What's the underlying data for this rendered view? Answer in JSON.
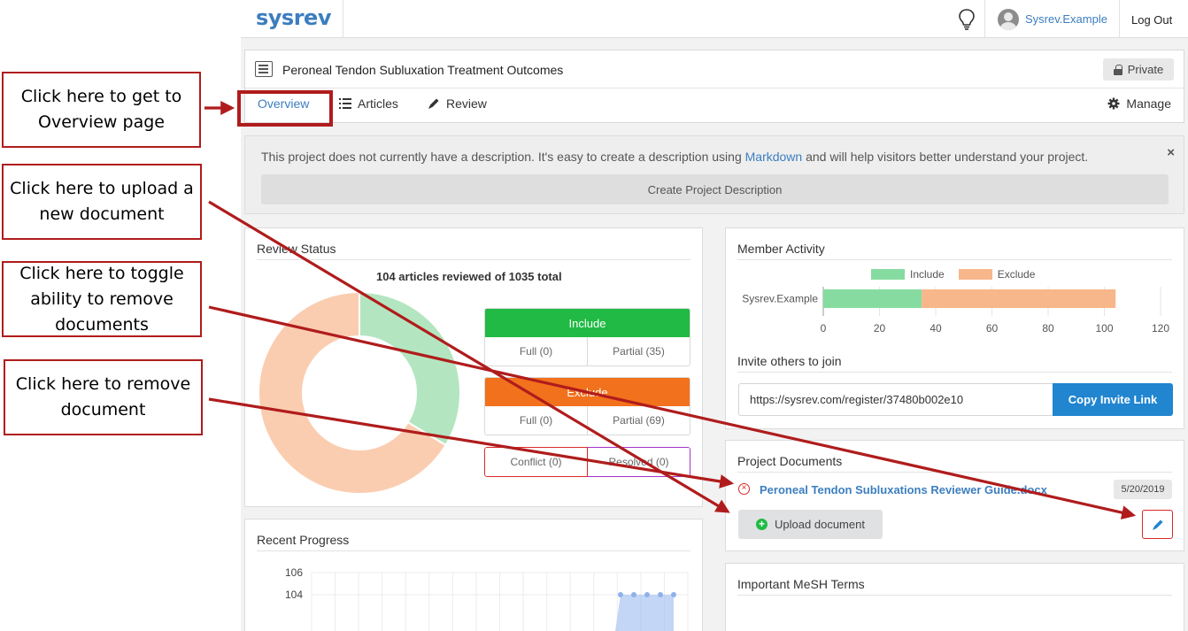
{
  "callouts": {
    "overview": "Click here to get to Overview page",
    "upload": "Click here to upload a new document",
    "toggle": "Click here to toggle ability to remove documents",
    "remove": "Click here to remove document"
  },
  "topbar": {
    "logo": "sysrev",
    "icons": [
      "lightbulb-icon",
      "avatar-icon"
    ],
    "username": "Sysrev.Example",
    "logout_label": "Log Out"
  },
  "project": {
    "title": "Peroneal Tendon Subluxation Treatment Outcomes",
    "visibility_label": "Private",
    "tabs": {
      "overview": "Overview",
      "articles": "Articles",
      "review": "Review",
      "manage": "Manage"
    }
  },
  "description_banner": {
    "text_before": "This project does not currently have a description. It's easy to create a description using ",
    "link": "Markdown",
    "text_after": " and will help visitors better understand your project.",
    "close": "×",
    "button_label": "Create Project Description"
  },
  "review_status": {
    "title": "Review Status",
    "caption": "104 articles reviewed of 1035 total",
    "include": {
      "label": "Include",
      "full": "Full (0)",
      "partial": "Partial (35)"
    },
    "exclude": {
      "label": "Exclude",
      "full": "Full (0)",
      "partial": "Partial (69)"
    },
    "conflict": "Conflict (0)",
    "resolved": "Resolved (0)",
    "chart_data": {
      "type": "pie",
      "categories": [
        "Include",
        "Exclude"
      ],
      "values": [
        35,
        69
      ],
      "colors": [
        "#b3e6c0",
        "#fbcdb0"
      ]
    }
  },
  "recent_progress": {
    "title": "Recent Progress",
    "chart_data": {
      "type": "area",
      "y_ticks": [
        "106",
        "104"
      ],
      "values": [
        104,
        104,
        104,
        104,
        104
      ],
      "color": "#a9c4f2"
    }
  },
  "member_activity": {
    "title": "Member Activity",
    "chart_data": {
      "type": "bar",
      "orientation": "horizontal",
      "stacked": true,
      "categories": [
        "Sysrev.Example"
      ],
      "series": [
        {
          "name": "Include",
          "values": [
            35
          ],
          "color": "#86dca0"
        },
        {
          "name": "Exclude",
          "values": [
            69
          ],
          "color": "#f8b78b"
        }
      ],
      "x_ticks": [
        "0",
        "20",
        "40",
        "60",
        "80",
        "100",
        "120"
      ],
      "xlim": [
        0,
        120
      ]
    },
    "invite_label": "Invite others to join",
    "invite_url": "https://sysrev.com/register/37480b002e10",
    "copy_label": "Copy Invite Link"
  },
  "project_documents": {
    "title": "Project Documents",
    "documents": [
      {
        "name": "Peroneal Tendon Subluxations Reviewer Guide.docx",
        "date": "5/20/2019"
      }
    ],
    "upload_label": "Upload document",
    "edit_icon": "pencil-icon"
  },
  "mesh_terms": {
    "title": "Important MeSH Terms"
  },
  "colors": {
    "brand": "#3c7ebf",
    "annotation": "#b01c1c",
    "include": "#21ba45",
    "exclude": "#f2711c",
    "primary_button": "#2185d0"
  }
}
